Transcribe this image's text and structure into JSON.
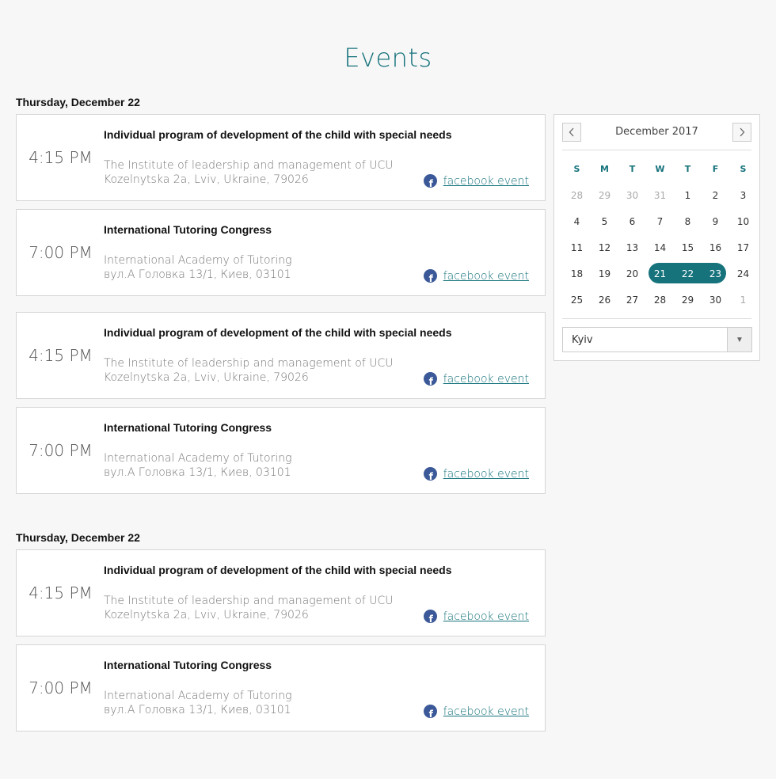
{
  "page": {
    "title": "Events"
  },
  "day_groups": [
    {
      "heading": "Thursday, December 22",
      "events": [
        {
          "time": "4:15 PM",
          "title": "Individual program of development of the child with special needs",
          "venue": "The Institute of leadership and management of UCU",
          "address": "Kozelnytska 2a, Lviv, Ukraine, 79026",
          "link": "facebook event"
        },
        {
          "time": "7:00 PM",
          "title": "International Tutoring Congress",
          "venue": "International Academy of Tutoring",
          "address": "вул.А Головка 13/1, Киев, 03101",
          "link": "facebook event"
        },
        {
          "time": "4:15 PM",
          "title": "Individual program of development of the child with special needs",
          "venue": "The Institute of leadership and management of UCU",
          "address": "Kozelnytska 2a, Lviv, Ukraine, 79026",
          "link": "facebook event"
        },
        {
          "time": "7:00 PM",
          "title": "International Tutoring Congress",
          "venue": "International Academy of Tutoring",
          "address": "вул.А Головка 13/1, Киев, 03101",
          "link": "facebook event"
        }
      ]
    },
    {
      "heading": "Thursday, December 22",
      "events": [
        {
          "time": "4:15 PM",
          "title": "Individual program of development of the child with special needs",
          "venue": "The Institute of leadership and management of UCU",
          "address": "Kozelnytska 2a, Lviv, Ukraine, 79026",
          "link": "facebook event"
        },
        {
          "time": "7:00 PM",
          "title": "International Tutoring Congress",
          "venue": "International Academy of Tutoring",
          "address": "вул.А Головка 13/1, Киев, 03101",
          "link": "facebook event"
        }
      ]
    }
  ],
  "calendar": {
    "month_label": "December 2017",
    "prev_icon": "chevron-left-icon",
    "next_icon": "chevron-right-icon",
    "weekdays": [
      "S",
      "M",
      "T",
      "W",
      "T",
      "F",
      "S"
    ],
    "weeks": [
      [
        "28",
        "29",
        "30",
        "31",
        "1",
        "2",
        "3"
      ],
      [
        "4",
        "5",
        "6",
        "7",
        "8",
        "9",
        "10"
      ],
      [
        "11",
        "12",
        "13",
        "14",
        "15",
        "16",
        "17"
      ],
      [
        "18",
        "19",
        "20",
        "21",
        "22",
        "23",
        "24"
      ],
      [
        "25",
        "26",
        "27",
        "28",
        "29",
        "30",
        "1"
      ]
    ],
    "selected_range": [
      "21",
      "22",
      "23"
    ],
    "accent_color": "#16737c"
  },
  "city_select": {
    "value": "Kyiv",
    "arrow_icon": "triangle-down-icon"
  }
}
